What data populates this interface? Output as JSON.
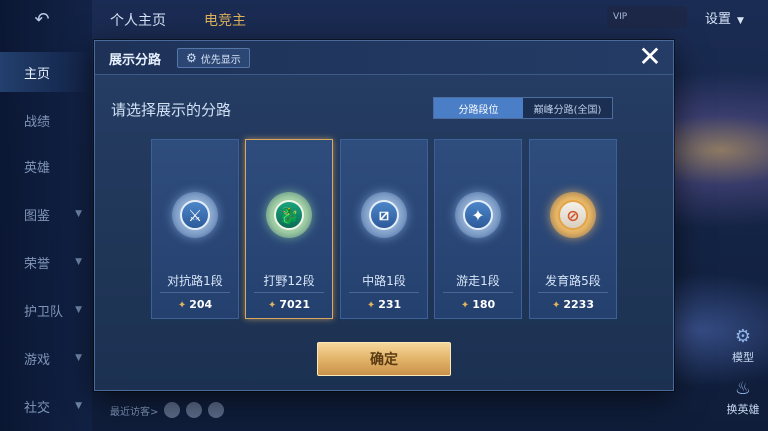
{
  "background": {
    "top_tabs": [
      "个人主页",
      "电竞主"
    ],
    "vip_label": "VIP",
    "settings_label": "设置",
    "recent_visit_label": "最近访客>",
    "bottom_buttons": [
      {
        "label": "模型",
        "icon": "model-icon"
      },
      {
        "label": "换英雄",
        "icon": "swap-hero-icon"
      }
    ]
  },
  "sidebar": {
    "items": [
      {
        "label": "主页",
        "active": true
      },
      {
        "label": "战绩",
        "active": false
      },
      {
        "label": "英雄",
        "active": false
      },
      {
        "label": "图鉴",
        "active": false,
        "chevron": true
      },
      {
        "label": "荣誉",
        "active": false,
        "chevron": true
      },
      {
        "label": "护卫队",
        "active": false,
        "chevron": true
      },
      {
        "label": "游戏",
        "active": false,
        "chevron": true
      },
      {
        "label": "社交",
        "active": false,
        "chevron": true
      }
    ]
  },
  "modal": {
    "title": "展示分路",
    "priority_button": "优先显示",
    "prompt": "请选择展示的分路",
    "toggle": {
      "options": [
        "分路段位",
        "巅峰分路(全国)"
      ],
      "selected_index": 0
    },
    "confirm_label": "确定"
  },
  "cards": [
    {
      "name": "对抗路1段",
      "value": "204",
      "emblem": "clash-lane-emblem-icon",
      "tier": "silver",
      "glyph": "⚔",
      "selected": false
    },
    {
      "name": "打野12段",
      "value": "7021",
      "emblem": "jungle-emblem-icon",
      "tier": "green",
      "glyph": "🐉",
      "selected": true
    },
    {
      "name": "中路1段",
      "value": "231",
      "emblem": "mid-lane-emblem-icon",
      "tier": "silver",
      "glyph": "⧄",
      "selected": false
    },
    {
      "name": "游走1段",
      "value": "180",
      "emblem": "roam-emblem-icon",
      "tier": "silver",
      "glyph": "✦",
      "selected": false
    },
    {
      "name": "发育路5段",
      "value": "2233",
      "emblem": "farm-lane-emblem-icon",
      "tier": "gold",
      "glyph": "⊘",
      "selected": false
    }
  ],
  "colors": {
    "accent_gold": "#e2b46a",
    "toggle_active": "#4a7fc8",
    "selected_border": "#d8a860"
  }
}
